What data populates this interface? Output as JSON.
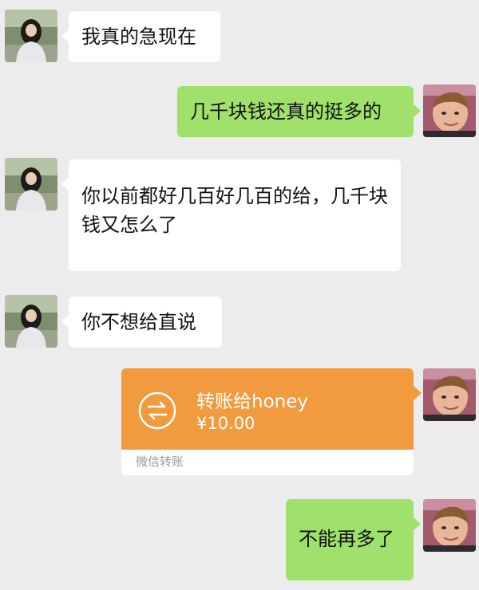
{
  "theme": {
    "background": "#ececec",
    "incoming_bubble": "#ffffff",
    "outgoing_bubble": "#9fe16a",
    "transfer_card": "#f19a3e"
  },
  "messages": [
    {
      "sender": "other",
      "text": "我真的急现在",
      "avatar": "girl-avatar"
    },
    {
      "sender": "me",
      "text": "几千块钱还真的挺多的",
      "avatar": "boy-avatar"
    },
    {
      "sender": "other",
      "text": "你以前都好几百好几百的给，几千块钱又怎么了",
      "avatar": "girl-avatar"
    },
    {
      "sender": "other",
      "text": "你不想给直说",
      "avatar": "girl-avatar"
    },
    {
      "sender": "me",
      "type": "transfer",
      "title": "转账给honey",
      "amount": "¥10.00",
      "footer": "微信转账",
      "icon": "transfer-arrows-icon",
      "avatar": "boy-avatar"
    },
    {
      "sender": "me",
      "text": "不能再多了",
      "avatar": "boy-avatar"
    }
  ]
}
